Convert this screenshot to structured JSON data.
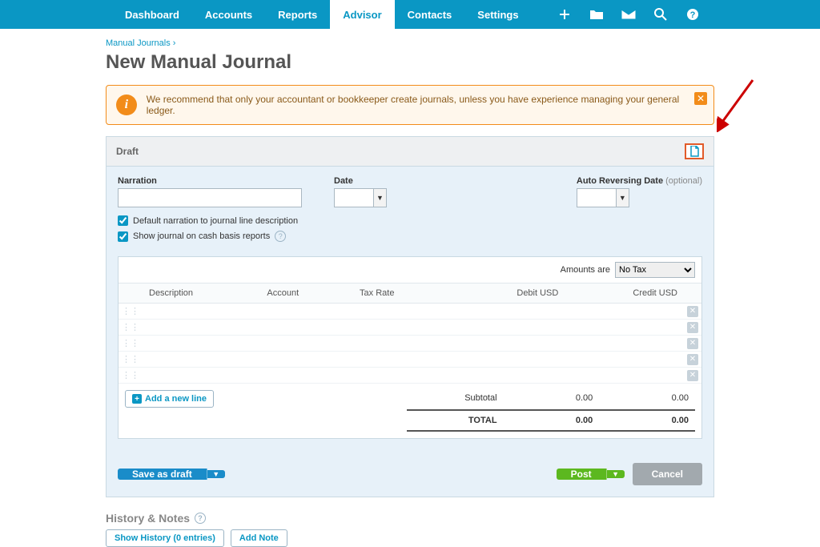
{
  "nav": {
    "items": [
      "Dashboard",
      "Accounts",
      "Reports",
      "Advisor",
      "Contacts",
      "Settings"
    ],
    "active_index": 3
  },
  "breadcrumb": {
    "parent": "Manual Journals",
    "sep": "›"
  },
  "page_title": "New Manual Journal",
  "alert": {
    "text": "We recommend that only your accountant or bookkeeper create journals, unless you have experience managing your general ledger."
  },
  "panel": {
    "status": "Draft",
    "fields": {
      "narration_label": "Narration",
      "narration_value": "",
      "date_label": "Date",
      "date_value": "",
      "auto_rev_label": "Auto Reversing Date",
      "auto_rev_optional": "(optional)",
      "auto_rev_value": ""
    },
    "checkboxes": {
      "default_narration": "Default narration to journal line description",
      "cash_basis": "Show journal on cash basis reports"
    },
    "amounts_are_label": "Amounts are",
    "amounts_are_value": "No Tax",
    "columns": {
      "description": "Description",
      "account": "Account",
      "tax_rate": "Tax Rate",
      "debit": "Debit USD",
      "credit": "Credit USD"
    },
    "add_line": "Add a new line",
    "totals": {
      "subtotal_label": "Subtotal",
      "subtotal_debit": "0.00",
      "subtotal_credit": "0.00",
      "total_label": "TOTAL",
      "total_debit": "0.00",
      "total_credit": "0.00"
    }
  },
  "actions": {
    "save_draft": "Save as draft",
    "post": "Post",
    "cancel": "Cancel"
  },
  "history": {
    "title": "History & Notes",
    "show": "Show History (0 entries)",
    "add_note": "Add Note"
  }
}
